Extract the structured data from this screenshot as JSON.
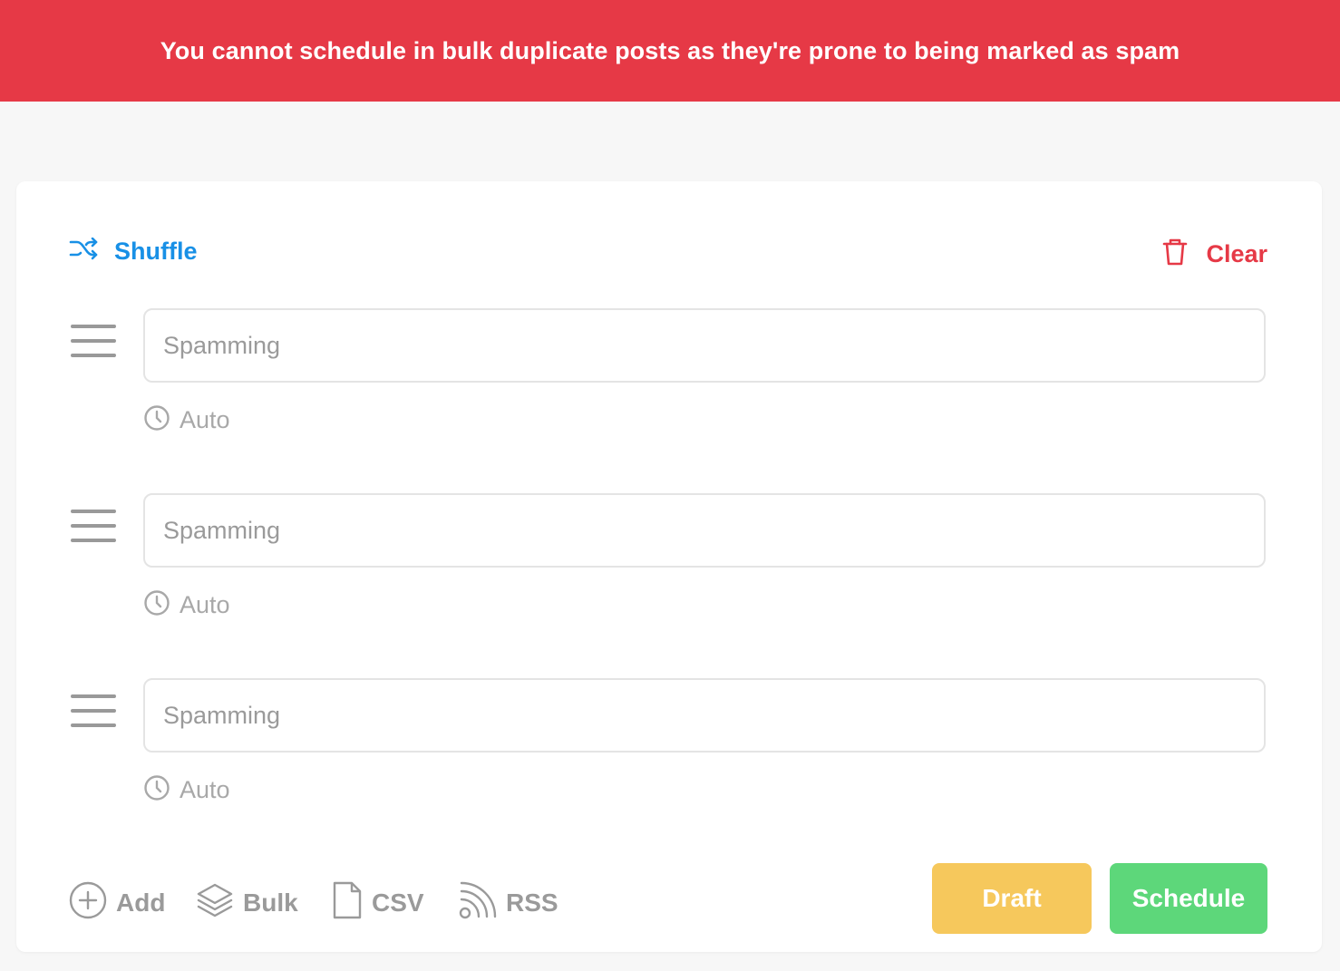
{
  "banner": {
    "message": "You cannot schedule in bulk duplicate posts as they're prone to being marked as spam"
  },
  "toolbar": {
    "shuffle_label": "Shuffle",
    "clear_label": "Clear"
  },
  "posts": [
    {
      "placeholder": "Spamming",
      "time_label": "Auto"
    },
    {
      "placeholder": "Spamming",
      "time_label": "Auto"
    },
    {
      "placeholder": "Spamming",
      "time_label": "Auto"
    }
  ],
  "footer": {
    "add_label": "Add",
    "bulk_label": "Bulk",
    "csv_label": "CSV",
    "rss_label": "RSS",
    "draft_label": "Draft",
    "schedule_label": "Schedule"
  },
  "colors": {
    "banner": "#e63946",
    "shuffle": "#1890e6",
    "clear": "#e63946",
    "draft": "#f6c85c",
    "schedule": "#5dd77a"
  },
  "icons": {
    "shuffle": "shuffle-icon",
    "clear": "trash-icon",
    "drag": "drag-handle-icon",
    "time": "clock-icon",
    "add": "plus-circle-icon",
    "bulk": "layers-icon",
    "csv": "file-icon",
    "rss": "rss-icon"
  }
}
